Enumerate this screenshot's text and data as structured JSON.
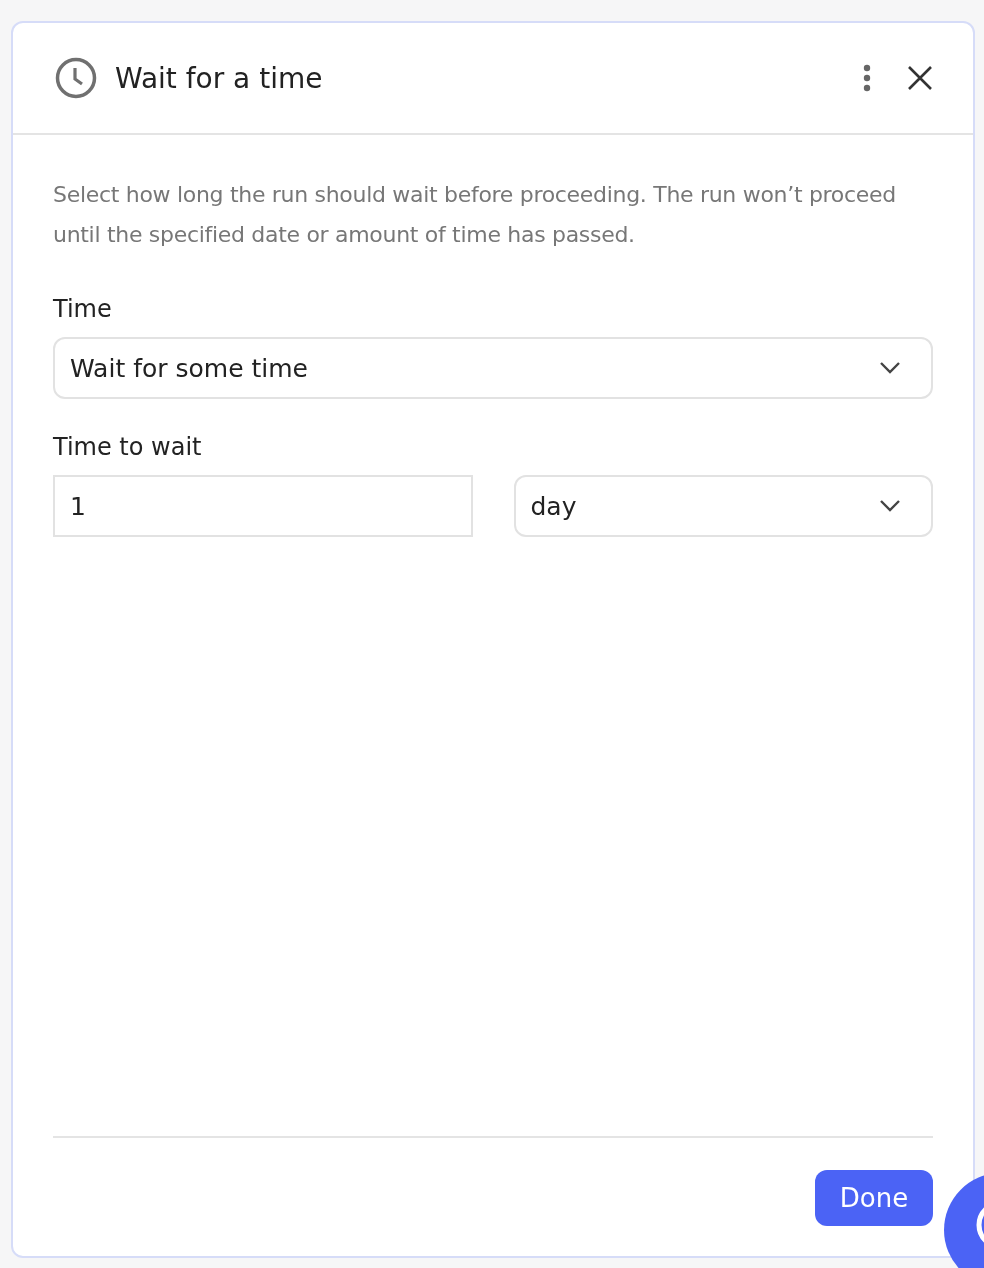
{
  "panel": {
    "title": "Wait for a time"
  },
  "description": "Select how long the run should wait before proceeding. The run won’t proceed until the specified date or amount of time has passed.",
  "fields": [
    {
      "label": "Time",
      "inputs": [
        {
          "kind": "select",
          "value": "Wait for some time"
        }
      ]
    },
    {
      "label": "Time to wait",
      "inputs": [
        {
          "kind": "text",
          "value": "1"
        },
        {
          "kind": "select",
          "value": "day"
        }
      ]
    }
  ],
  "footer": {
    "button": "Done"
  }
}
